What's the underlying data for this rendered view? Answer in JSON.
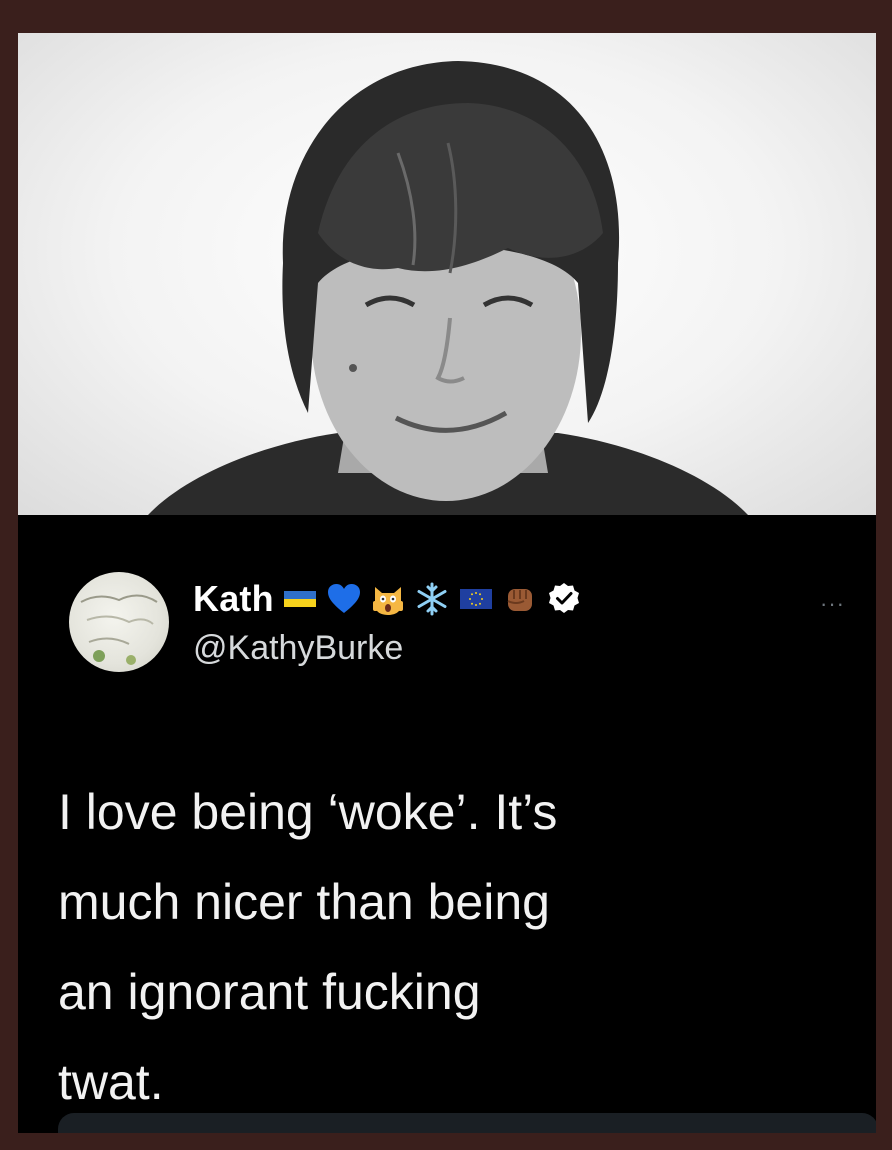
{
  "tweet": {
    "display_name": "Kath",
    "handle": "@KathyBurke",
    "more_label": "···",
    "name_emojis": [
      "ukraine-flag-icon",
      "blue-heart-icon",
      "screaming-cat-icon",
      "snowflake-icon",
      "eu-flag-icon",
      "raised-fist-icon",
      "verified-badge-icon"
    ],
    "text_lines": [
      "I love being ‘woke’. It’s",
      "much nicer than being",
      "an ignorant fucking",
      "twat."
    ]
  },
  "colors": {
    "background": "#000000",
    "outer_border": "#3a1f1c",
    "name": "#ffffff",
    "handle": "#d6d9db",
    "ukraine_blue": "#2f6fc8",
    "ukraine_yellow": "#f6d21c",
    "heart_blue": "#1e6ee8",
    "eu_blue": "#1f3fa0"
  }
}
